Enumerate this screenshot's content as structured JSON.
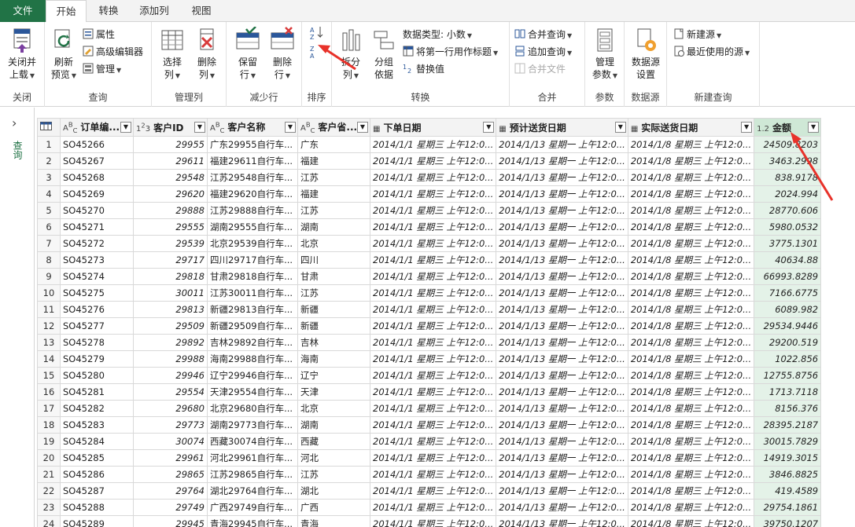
{
  "tabs": [
    "文件",
    "开始",
    "转换",
    "添加列",
    "视图"
  ],
  "ribbon": {
    "close": {
      "btn": "关闭并上载",
      "btn_l1": "关闭并",
      "btn_l2": "上载",
      "group": "关闭"
    },
    "query": {
      "refresh_l1": "刷新",
      "refresh_l2": "预览",
      "properties": "属性",
      "adv_editor": "高级编辑器",
      "manage": "管理",
      "group": "查询"
    },
    "columns": {
      "choose_l1": "选择",
      "choose_l2": "列",
      "remove_l1": "删除",
      "remove_l2": "列",
      "group": "管理列"
    },
    "rows": {
      "keep_l1": "保留",
      "keep_l2": "行",
      "remove_l1": "删除",
      "remove_l2": "行",
      "group": "减少行"
    },
    "sort": {
      "asc": "A↓Z",
      "desc": "Z↓A",
      "group": "排序"
    },
    "transform": {
      "split_l1": "拆分",
      "split_l2": "列",
      "group_l1": "分组",
      "group_l2": "依据",
      "datatype": "数据类型: 小数",
      "first_row": "将第一行用作标题",
      "replace": "替换值",
      "group": "转换"
    },
    "combine": {
      "merge": "合并查询",
      "append": "追加查询",
      "merge_files": "合并文件",
      "group": "合并"
    },
    "params": {
      "manage_l1": "管理",
      "manage_l2": "参数",
      "group": "参数"
    },
    "datasource": {
      "settings_l1": "数据源",
      "settings_l2": "设置",
      "group": "数据源"
    },
    "newquery": {
      "new_source": "新建源",
      "recent": "最近使用的源",
      "group": "新建查询"
    }
  },
  "nav": {
    "label": "查询"
  },
  "columns": [
    {
      "name": "订单编...",
      "type": "ABC"
    },
    {
      "name": "客户ID",
      "type": "123"
    },
    {
      "name": "客户名称",
      "type": "ABC"
    },
    {
      "name": "客户省...",
      "type": "ABC"
    },
    {
      "name": "下单日期",
      "type": "date"
    },
    {
      "name": "预计送货日期",
      "type": "date"
    },
    {
      "name": "实际送货日期",
      "type": "date"
    },
    {
      "name": "金额",
      "type": "1.2"
    }
  ],
  "rows": [
    [
      "1",
      "SO45266",
      "29955",
      "广东29955自行车...",
      "广东",
      "2014/1/1 星期三 上午12:0...",
      "2014/1/13 星期一 上午12:0...",
      "2014/1/8 星期三 上午12:0...",
      "24509.8203"
    ],
    [
      "2",
      "SO45267",
      "29611",
      "福建29611自行车...",
      "福建",
      "2014/1/1 星期三 上午12:0...",
      "2014/1/13 星期一 上午12:0...",
      "2014/1/8 星期三 上午12:0...",
      "3463.2998"
    ],
    [
      "3",
      "SO45268",
      "29548",
      "江苏29548自行车...",
      "江苏",
      "2014/1/1 星期三 上午12:0...",
      "2014/1/13 星期一 上午12:0...",
      "2014/1/8 星期三 上午12:0...",
      "838.9178"
    ],
    [
      "4",
      "SO45269",
      "29620",
      "福建29620自行车...",
      "福建",
      "2014/1/1 星期三 上午12:0...",
      "2014/1/13 星期一 上午12:0...",
      "2014/1/8 星期三 上午12:0...",
      "2024.994"
    ],
    [
      "5",
      "SO45270",
      "29888",
      "江苏29888自行车...",
      "江苏",
      "2014/1/1 星期三 上午12:0...",
      "2014/1/13 星期一 上午12:0...",
      "2014/1/8 星期三 上午12:0...",
      "28770.606"
    ],
    [
      "6",
      "SO45271",
      "29555",
      "湖南29555自行车...",
      "湖南",
      "2014/1/1 星期三 上午12:0...",
      "2014/1/13 星期一 上午12:0...",
      "2014/1/8 星期三 上午12:0...",
      "5980.0532"
    ],
    [
      "7",
      "SO45272",
      "29539",
      "北京29539自行车...",
      "北京",
      "2014/1/1 星期三 上午12:0...",
      "2014/1/13 星期一 上午12:0...",
      "2014/1/8 星期三 上午12:0...",
      "3775.1301"
    ],
    [
      "8",
      "SO45273",
      "29717",
      "四川29717自行车...",
      "四川",
      "2014/1/1 星期三 上午12:0...",
      "2014/1/13 星期一 上午12:0...",
      "2014/1/8 星期三 上午12:0...",
      "40634.88"
    ],
    [
      "9",
      "SO45274",
      "29818",
      "甘肃29818自行车...",
      "甘肃",
      "2014/1/1 星期三 上午12:0...",
      "2014/1/13 星期一 上午12:0...",
      "2014/1/8 星期三 上午12:0...",
      "66993.8289"
    ],
    [
      "10",
      "SO45275",
      "30011",
      "江苏30011自行车...",
      "江苏",
      "2014/1/1 星期三 上午12:0...",
      "2014/1/13 星期一 上午12:0...",
      "2014/1/8 星期三 上午12:0...",
      "7166.6775"
    ],
    [
      "11",
      "SO45276",
      "29813",
      "新疆29813自行车...",
      "新疆",
      "2014/1/1 星期三 上午12:0...",
      "2014/1/13 星期一 上午12:0...",
      "2014/1/8 星期三 上午12:0...",
      "6089.982"
    ],
    [
      "12",
      "SO45277",
      "29509",
      "新疆29509自行车...",
      "新疆",
      "2014/1/1 星期三 上午12:0...",
      "2014/1/13 星期一 上午12:0...",
      "2014/1/8 星期三 上午12:0...",
      "29534.9446"
    ],
    [
      "13",
      "SO45278",
      "29892",
      "吉林29892自行车...",
      "吉林",
      "2014/1/1 星期三 上午12:0...",
      "2014/1/13 星期一 上午12:0...",
      "2014/1/8 星期三 上午12:0...",
      "29200.519"
    ],
    [
      "14",
      "SO45279",
      "29988",
      "海南29988自行车...",
      "海南",
      "2014/1/1 星期三 上午12:0...",
      "2014/1/13 星期一 上午12:0...",
      "2014/1/8 星期三 上午12:0...",
      "1022.856"
    ],
    [
      "15",
      "SO45280",
      "29946",
      "辽宁29946自行车...",
      "辽宁",
      "2014/1/1 星期三 上午12:0...",
      "2014/1/13 星期一 上午12:0...",
      "2014/1/8 星期三 上午12:0...",
      "12755.8756"
    ],
    [
      "16",
      "SO45281",
      "29554",
      "天津29554自行车...",
      "天津",
      "2014/1/1 星期三 上午12:0...",
      "2014/1/13 星期一 上午12:0...",
      "2014/1/8 星期三 上午12:0...",
      "1713.7118"
    ],
    [
      "17",
      "SO45282",
      "29680",
      "北京29680自行车...",
      "北京",
      "2014/1/1 星期三 上午12:0...",
      "2014/1/13 星期一 上午12:0...",
      "2014/1/8 星期三 上午12:0...",
      "8156.376"
    ],
    [
      "18",
      "SO45283",
      "29773",
      "湖南29773自行车...",
      "湖南",
      "2014/1/1 星期三 上午12:0...",
      "2014/1/13 星期一 上午12:0...",
      "2014/1/8 星期三 上午12:0...",
      "28395.2187"
    ],
    [
      "19",
      "SO45284",
      "30074",
      "西藏30074自行车...",
      "西藏",
      "2014/1/1 星期三 上午12:0...",
      "2014/1/13 星期一 上午12:0...",
      "2014/1/8 星期三 上午12:0...",
      "30015.7829"
    ],
    [
      "20",
      "SO45285",
      "29961",
      "河北29961自行车...",
      "河北",
      "2014/1/1 星期三 上午12:0...",
      "2014/1/13 星期一 上午12:0...",
      "2014/1/8 星期三 上午12:0...",
      "14919.3015"
    ],
    [
      "21",
      "SO45286",
      "29865",
      "江苏29865自行车...",
      "江苏",
      "2014/1/1 星期三 上午12:0...",
      "2014/1/13 星期一 上午12:0...",
      "2014/1/8 星期三 上午12:0...",
      "3846.8825"
    ],
    [
      "22",
      "SO45287",
      "29764",
      "湖北29764自行车...",
      "湖北",
      "2014/1/1 星期三 上午12:0...",
      "2014/1/13 星期一 上午12:0...",
      "2014/1/8 星期三 上午12:0...",
      "419.4589"
    ],
    [
      "23",
      "SO45288",
      "29749",
      "广西29749自行车...",
      "广西",
      "2014/1/1 星期三 上午12:0...",
      "2014/1/13 星期一 上午12:0...",
      "2014/1/8 星期三 上午12:0...",
      "29754.1861"
    ],
    [
      "24",
      "SO45289",
      "29945",
      "青海29945自行车...",
      "青海",
      "2014/1/1 星期三 上午12:0...",
      "2014/1/13 星期一 上午12:0...",
      "2014/1/8 星期三 上午12:0...",
      "39750.1207"
    ]
  ],
  "colors": {
    "accent": "#217346",
    "amount_bg": "#e4f2e8",
    "arrow": "#e8322a"
  }
}
